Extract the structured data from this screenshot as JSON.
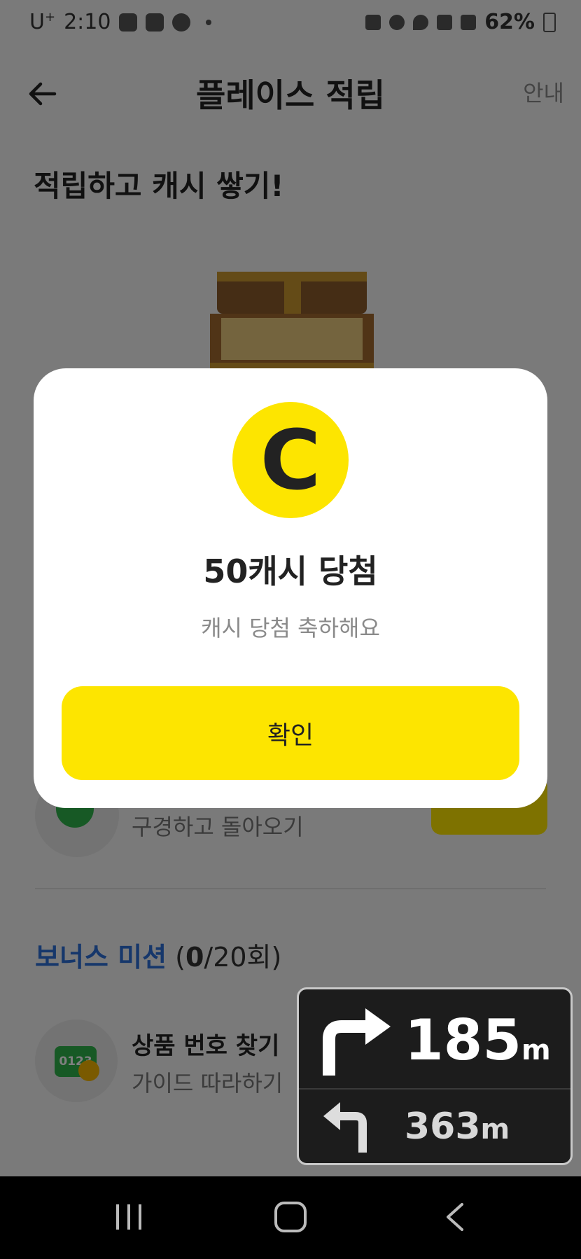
{
  "status_bar": {
    "carrier": "U",
    "carrier_sup": "+",
    "time": "2:10",
    "battery": "62%",
    "icons": [
      "pill-icon",
      "image-icon",
      "car-icon",
      "dot-icon",
      "bed-icon",
      "alarm-icon",
      "location-icon",
      "wifi-icon",
      "signal-icon",
      "battery-icon"
    ]
  },
  "header": {
    "title": "플레이스 적립",
    "guide_label": "안내"
  },
  "headline": "적립하고 캐시 쌓기!",
  "mission": {
    "subtitle": "구경하고 돌아오기"
  },
  "bonus": {
    "label": "보너스 미션",
    "count_open": " (",
    "count_done": "0",
    "count_rest": "/20회)",
    "item": {
      "icon_text": "0123",
      "name": "상품 번호 찾기",
      "desc": "가이드 따라하기"
    }
  },
  "modal": {
    "coin_letter": "C",
    "title": "50캐시 당첨",
    "subtitle": "캐시 당첨 축하해요",
    "confirm_label": "확인"
  },
  "navigation": {
    "first_distance": "185",
    "first_unit": "m",
    "second_distance": "363",
    "second_unit": "m"
  },
  "colors": {
    "accent_yellow": "#fde500",
    "bonus_blue": "#2d6fd6",
    "mission_green": "#2fb24a"
  }
}
